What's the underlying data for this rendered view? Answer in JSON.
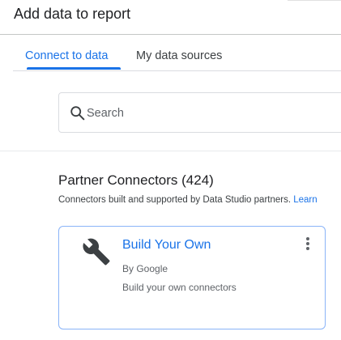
{
  "dialog": {
    "title": "Add data to report"
  },
  "tabs": [
    {
      "label": "Connect to data",
      "active": true
    },
    {
      "label": "My data sources",
      "active": false
    }
  ],
  "search": {
    "placeholder": "Search",
    "value": ""
  },
  "section": {
    "title": "Partner Connectors (424)",
    "description": "Connectors built and supported by Data Studio partners.",
    "learn_more": "Learn"
  },
  "connector_card": {
    "title": "Build Your Own",
    "by": "By Google",
    "description": "Build your own connectors",
    "icon": "wrench-icon"
  },
  "colors": {
    "accent": "#1a73e8",
    "card_border": "#8ab4f8",
    "text_primary": "#202124",
    "text_secondary": "#5f6368"
  }
}
